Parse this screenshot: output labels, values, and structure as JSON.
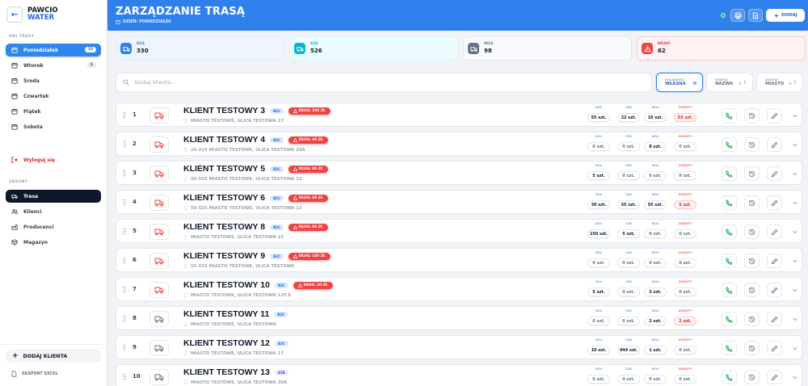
{
  "brand": {
    "line1": "PAWCIO",
    "line2": "WATER",
    "logo_glyph": "←"
  },
  "sidebar": {
    "section_days": "DNI TRASY",
    "days": [
      {
        "label": "Poniedziałek",
        "badge": "10",
        "active": true
      },
      {
        "label": "Wtorek",
        "badge": "1",
        "active": false
      },
      {
        "label": "Środa",
        "badge": "",
        "active": false
      },
      {
        "label": "Czwartek",
        "badge": "",
        "active": false
      },
      {
        "label": "Piątek",
        "badge": "",
        "active": false
      },
      {
        "label": "Sobota",
        "badge": "",
        "active": false
      }
    ],
    "logout": "Wyloguj się",
    "section_resources": "ZASOBY",
    "resources": [
      {
        "label": "Trasa",
        "icon": "truck-icon",
        "active": true
      },
      {
        "label": "Klienci",
        "icon": "users-icon",
        "active": false
      },
      {
        "label": "Producenci",
        "icon": "factory-icon",
        "active": false
      },
      {
        "label": "Magazyn",
        "icon": "box-icon",
        "active": false
      }
    ],
    "add_client": "DODAJ KLIENTA",
    "export": "EKSPORT EXCEL"
  },
  "header": {
    "title": "ZARZĄDZANIE TRASĄ",
    "subtitle": "DZIEŃ: PONIEDZIAŁEK",
    "add_label": "DODAJ"
  },
  "stats": [
    {
      "label": "D24",
      "value": "330",
      "color": "#2f80ed"
    },
    {
      "label": "S26",
      "value": "526",
      "color": "#06b6d4"
    },
    {
      "label": "W24",
      "value": "98",
      "color": "#64748b"
    },
    {
      "label": "BRAKI",
      "value": "62",
      "color": "#ef4444"
    }
  ],
  "search": {
    "placeholder": "Szukaj klienta..."
  },
  "sort": [
    {
      "top": "KOLEJNOŚĆ",
      "main": "WŁASNA",
      "arrow": "≡",
      "active": true
    },
    {
      "top": "SORTUJ",
      "main": "NAZWA",
      "arrow": "↓↑",
      "active": false
    },
    {
      "top": "SORTUJ",
      "main": "MIASTO",
      "arrow": "↓↑",
      "active": false
    }
  ],
  "qty_labels": [
    "D24",
    "S26",
    "W24",
    "ZWROTY"
  ],
  "rows": [
    {
      "n": "1",
      "name": "KLIENT TESTOWY 3",
      "type": "B2C",
      "debt": "DŁUG: 200 ZŁ",
      "addr": "MIASTO TESTOWE, ULICA TESTOWA 17",
      "q": [
        "55 szt.",
        "22 szt.",
        "16 szt.",
        "53 szt."
      ],
      "alert": true
    },
    {
      "n": "2",
      "name": "KLIENT TESTOWY 4",
      "type": "B2C",
      "debt": "DŁUG: 60 ZŁ",
      "addr": "26-224 MIASTO TESTOWE, ULICA TESTOWA 20A",
      "q": [
        "0 szt.",
        "0 szt.",
        "8 szt.",
        "0 szt."
      ],
      "alert": true
    },
    {
      "n": "3",
      "name": "KLIENT TESTOWY 5",
      "type": "B2C",
      "debt": "DŁUG: 80 ZŁ",
      "addr": "55-555 MIASTO TESTOWE, ULICA TESTOWA 12",
      "q": [
        "5 szt.",
        "0 szt.",
        "0 szt.",
        "0 szt."
      ],
      "alert": true
    },
    {
      "n": "4",
      "name": "KLIENT TESTOWY 6",
      "type": "B2C",
      "debt": "DŁUG: 60 ZŁ",
      "addr": "55-555 MIASTO TESTOWE, ULICA TESTOWA 12",
      "q": [
        "30 szt.",
        "55 szt.",
        "55 szt.",
        "5 szt."
      ],
      "alert": true
    },
    {
      "n": "5",
      "name": "KLIENT TESTOWY 8",
      "type": "B2C",
      "debt": "DŁUG: 80 ZŁ",
      "addr": "MIASTO TESTOWE, ULICA TESTOWA 22",
      "q": [
        "150 szt.",
        "5 szt.",
        "0 szt.",
        "0 szt."
      ],
      "alert": true
    },
    {
      "n": "6",
      "name": "KLIENT TESTOWY 9",
      "type": "B2C",
      "debt": "DŁUG: 105 ZŁ",
      "addr": "55-555 MIASTO TESTOWE, ULICA TESTOWA",
      "q": [
        "0 szt.",
        "0 szt.",
        "0 szt.",
        "0 szt."
      ],
      "alert": true
    },
    {
      "n": "7",
      "name": "KLIENT TESTOWY 10",
      "type": "B2C",
      "debt": "DŁUG: 20 ZŁ",
      "addr": "MIASTO TESTOWE, ULICA TESTOWA 125 E",
      "q": [
        "5 szt.",
        "0 szt.",
        "3 szt.",
        "0 szt."
      ],
      "alert": true
    },
    {
      "n": "8",
      "name": "KLIENT TESTOWY 11",
      "type": "B2C",
      "debt": "",
      "addr": "MIASTO TESTOWE, ULICA TESTOWA",
      "q": [
        "0 szt.",
        "0 szt.",
        "2 szt.",
        "2 szt."
      ],
      "alert": false
    },
    {
      "n": "9",
      "name": "KLIENT TESTOWY 12",
      "type": "B2C",
      "debt": "",
      "addr": "MIASTO TESTOWE, ULICA TESTOWA 17",
      "q": [
        "10 szt.",
        "444 szt.",
        "1 szt.",
        "0 szt."
      ],
      "alert": false
    },
    {
      "n": "10",
      "name": "KLIENT TESTOWY 13",
      "type": "B2B",
      "debt": "",
      "addr": "MIASTO TESTOWE, ULICA TESTOWA 30A",
      "q": [
        "0 szt.",
        "0 szt.",
        "0 szt.",
        "0 szt."
      ],
      "alert": false
    }
  ]
}
